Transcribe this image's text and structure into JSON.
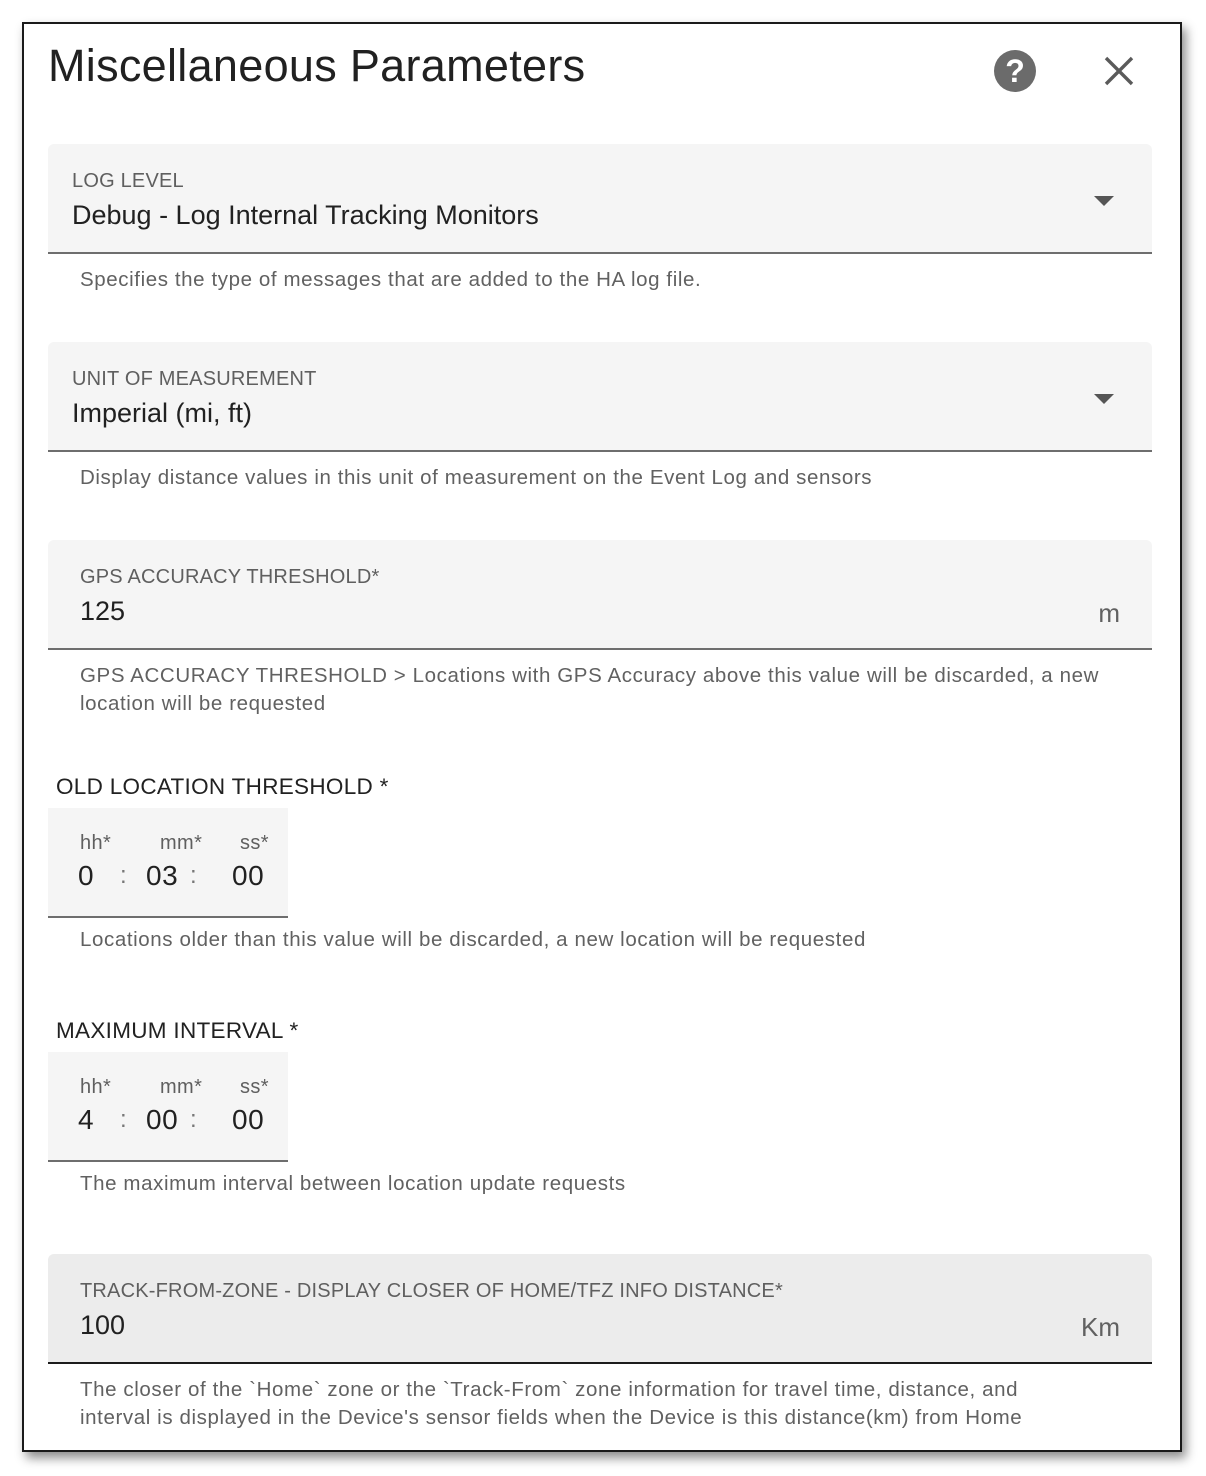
{
  "dialog": {
    "title": "Miscellaneous Parameters",
    "help_icon": "help-circle-icon",
    "help_glyph": "?",
    "close_icon": "close-icon"
  },
  "log_level": {
    "label": "LOG LEVEL",
    "value": "Debug - Log Internal Tracking Monitors",
    "helper": "Specifies the type of messages that are added to the HA log file."
  },
  "unit_of_measurement": {
    "label": "UNIT OF MEASUREMENT",
    "value": "Imperial (mi, ft)",
    "helper": "Display distance values in this unit of measurement on the Event Log and sensors"
  },
  "gps_accuracy": {
    "label": "GPS ACCURACY THRESHOLD*",
    "value": "125",
    "suffix": "m",
    "helper": "GPS ACCURACY THRESHOLD > Locations with GPS Accuracy above this value will be discarded, a new location will be requested"
  },
  "old_location": {
    "title": "OLD LOCATION THRESHOLD *",
    "hh_label": "hh*",
    "mm_label": "mm*",
    "ss_label": "ss*",
    "hh": "0",
    "mm": "03",
    "ss": "00",
    "separator": ":",
    "helper": "Locations older than this value will be discarded, a new location will be requested"
  },
  "max_interval": {
    "title": "MAXIMUM INTERVAL *",
    "hh_label": "hh*",
    "mm_label": "mm*",
    "ss_label": "ss*",
    "hh": "4",
    "mm": "00",
    "ss": "00",
    "separator": ":",
    "helper": "The maximum interval between location update requests"
  },
  "track_from_zone": {
    "label": "TRACK-FROM-ZONE - DISPLAY CLOSER OF HOME/TFZ INFO DISTANCE*",
    "value": "100",
    "suffix": "Km",
    "helper_line1": "The closer of the `Home` zone or the `Track-From` zone information for travel time, distance, and",
    "helper_line2": "interval is displayed in the Device's sensor fields when the Device is this distance(km) from Home"
  }
}
